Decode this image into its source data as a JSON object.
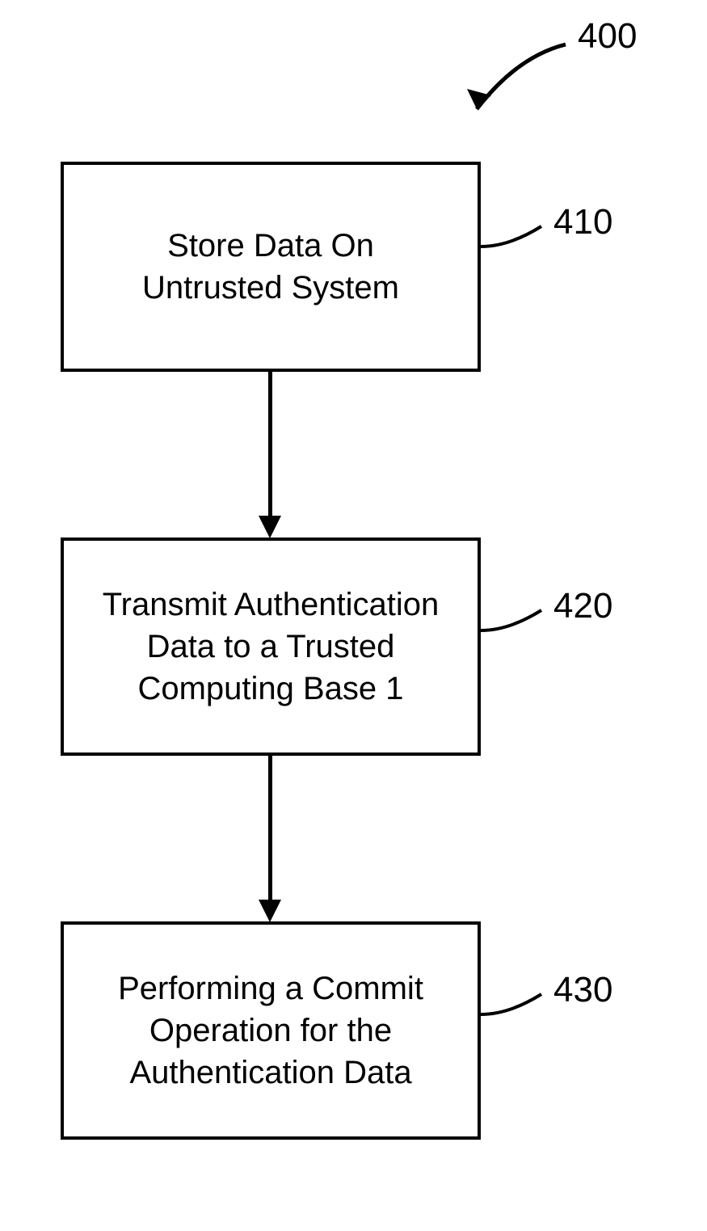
{
  "diagram": {
    "title_label": "400",
    "boxes": [
      {
        "id": "box1",
        "text": "Store Data On\nUntrusted System",
        "label": "410"
      },
      {
        "id": "box2",
        "text": "Transmit Authentication\nData to a Trusted\nComputing Base 1",
        "label": "420"
      },
      {
        "id": "box3",
        "text": "Performing a Commit\nOperation for the\nAuthentication Data",
        "label": "430"
      }
    ]
  }
}
